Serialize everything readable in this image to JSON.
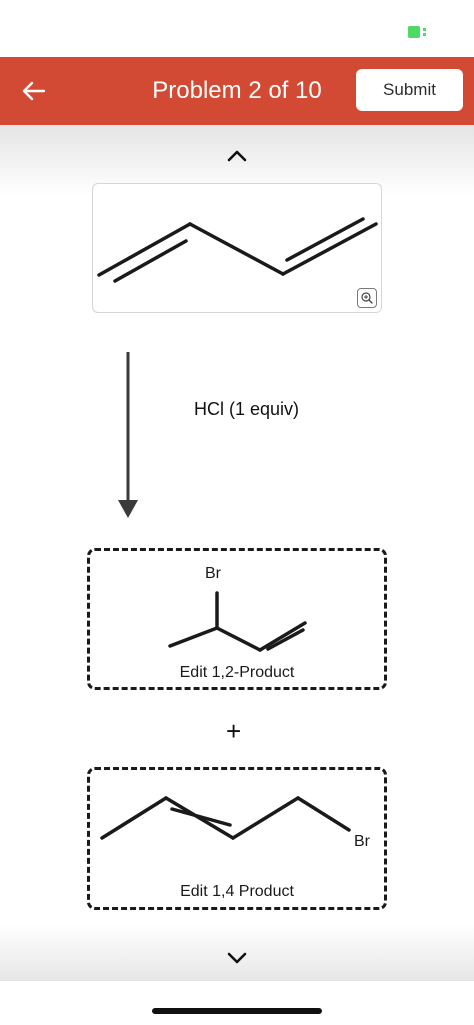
{
  "header": {
    "title": "Problem 2 of 10",
    "submit_label": "Submit",
    "color": "#d24a34"
  },
  "reaction": {
    "reagent": "HCl (1 equiv)"
  },
  "products": [
    {
      "label": "Edit 1,2-Product",
      "atom": "Br"
    },
    {
      "label": "Edit 1,4 Product",
      "atom": "Br"
    }
  ],
  "plus": "+",
  "icons": {
    "back": "arrow-left-icon",
    "zoom": "zoom-icon",
    "up": "chevron-up-icon",
    "down": "chevron-down-icon",
    "battery": "battery-icon"
  },
  "colors": {
    "battery": "#4cd964"
  }
}
